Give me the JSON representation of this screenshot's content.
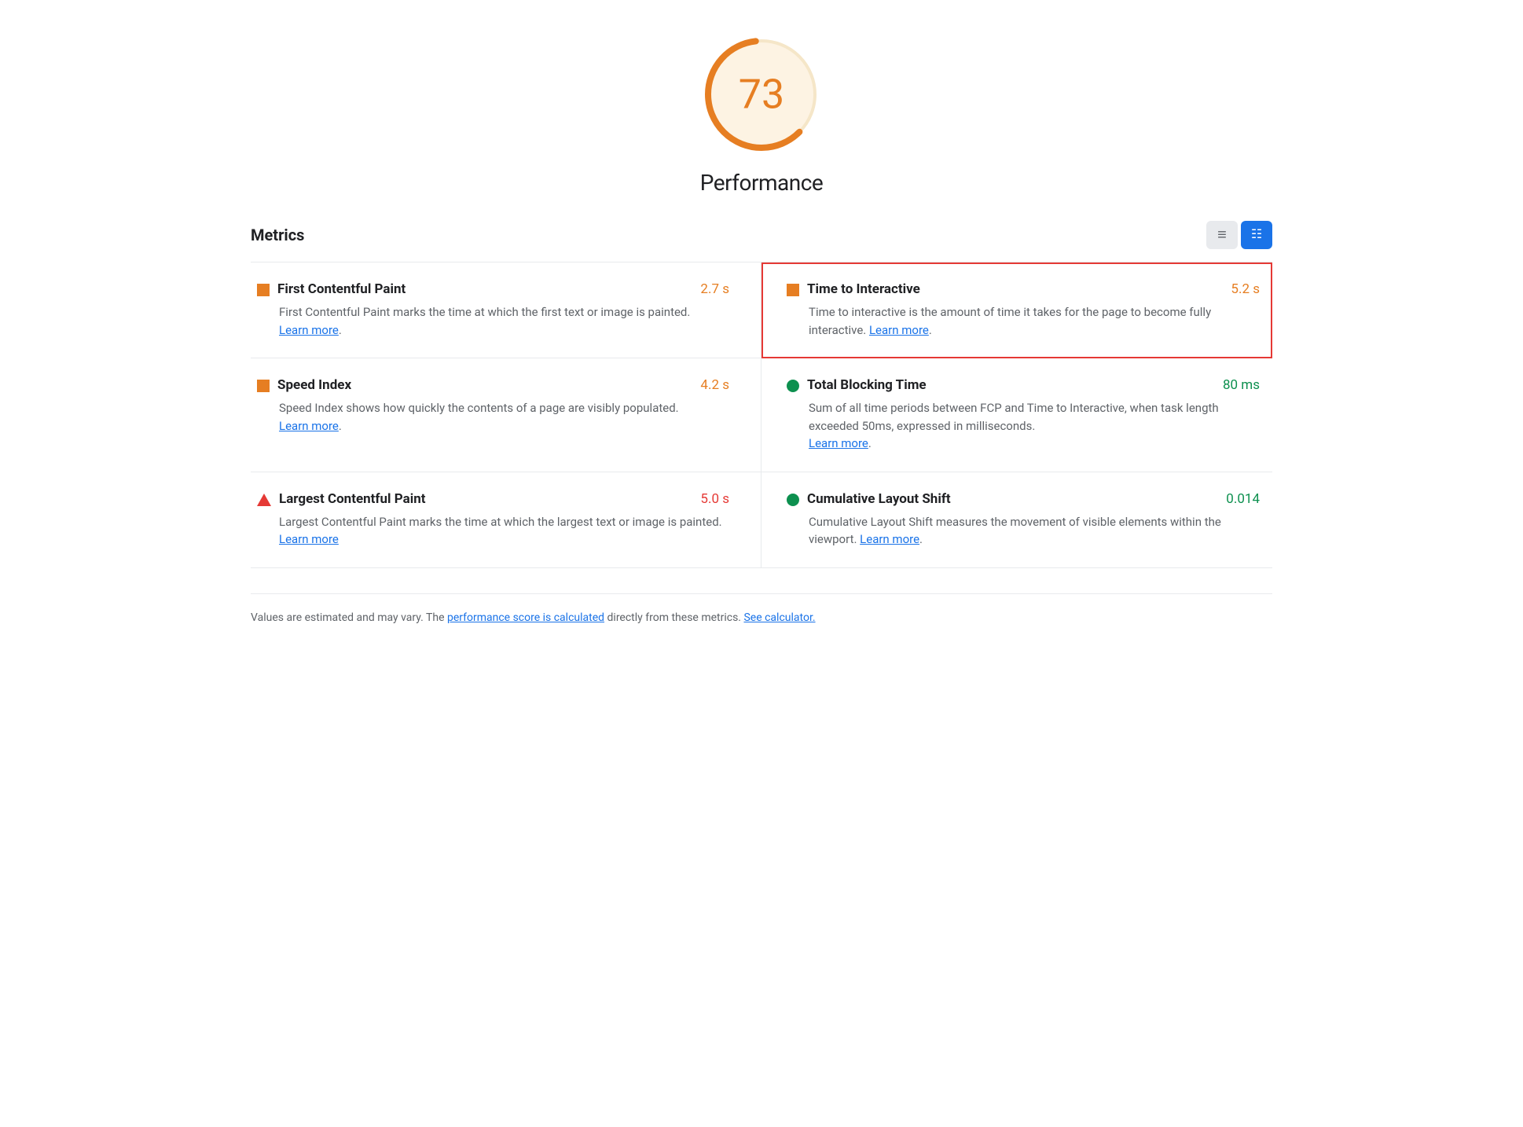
{
  "score": {
    "value": "73",
    "label": "Performance",
    "color": "#e67e22",
    "bg_color": "#fdf3e3"
  },
  "metrics_title": "Metrics",
  "toggle": {
    "list_icon": "≡",
    "grid_icon": "⊞"
  },
  "metrics": [
    {
      "id": "fcp",
      "name": "First Contentful Paint",
      "value": "2.7 s",
      "value_class": "orange",
      "icon": "square",
      "description": "First Contentful Paint marks the time at which the first text or image is painted.",
      "learn_more": "Learn more",
      "highlighted": false,
      "position": "left"
    },
    {
      "id": "tti",
      "name": "Time to Interactive",
      "value": "5.2 s",
      "value_class": "orange",
      "icon": "square",
      "description": "Time to interactive is the amount of time it takes for the page to become fully interactive.",
      "learn_more": "Learn more",
      "highlighted": true,
      "position": "right"
    },
    {
      "id": "si",
      "name": "Speed Index",
      "value": "4.2 s",
      "value_class": "orange",
      "icon": "square",
      "description": "Speed Index shows how quickly the contents of a page are visibly populated.",
      "learn_more": "Learn more",
      "highlighted": false,
      "position": "left"
    },
    {
      "id": "tbt",
      "name": "Total Blocking Time",
      "value": "80 ms",
      "value_class": "green",
      "icon": "circle",
      "description": "Sum of all time periods between FCP and Time to Interactive, when task length exceeded 50ms, expressed in milliseconds.",
      "learn_more": "Learn more",
      "highlighted": false,
      "position": "right"
    },
    {
      "id": "lcp",
      "name": "Largest Contentful Paint",
      "value": "5.0 s",
      "value_class": "red",
      "icon": "triangle",
      "description": "Largest Contentful Paint marks the time at which the largest text or image is painted.",
      "learn_more": "Learn more",
      "highlighted": false,
      "position": "left"
    },
    {
      "id": "cls",
      "name": "Cumulative Layout Shift",
      "value": "0.014",
      "value_class": "green",
      "icon": "circle",
      "description": "Cumulative Layout Shift measures the movement of visible elements within the viewport.",
      "learn_more": "Learn more",
      "highlighted": false,
      "position": "right"
    }
  ],
  "footer": {
    "text_before": "Values are estimated and may vary. The ",
    "link1_text": "performance score is calculated",
    "text_middle": " directly from these metrics. ",
    "link2_text": "See calculator."
  }
}
